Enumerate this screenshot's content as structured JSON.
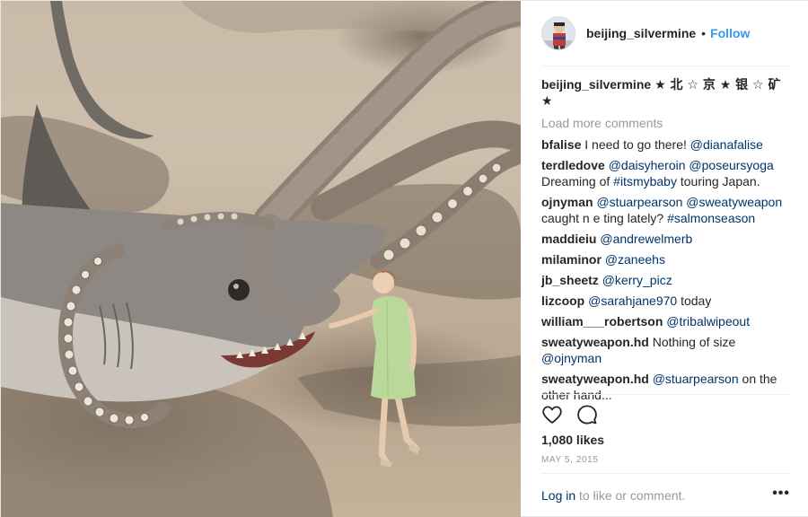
{
  "post": {
    "author": "beijing_silvermine",
    "follow_label": "Follow",
    "separator": "•",
    "caption": "★ 北 ☆ 京 ★ 银 ☆ 矿 ★",
    "load_more": "Load more comments",
    "likes": "1,080 likes",
    "date": "MAY 5, 2015",
    "login_link": "Log in",
    "login_rest": " to like or comment.",
    "more_icon": "•••"
  },
  "comments": [
    {
      "user": "bfalise",
      "parts": [
        {
          "t": "I need to go there! "
        },
        {
          "t": "@dianafalise",
          "m": true
        }
      ]
    },
    {
      "user": "terdledove",
      "parts": [
        {
          "t": "@daisyheroin",
          "m": true
        },
        {
          "t": " "
        },
        {
          "t": "@poseursyoga",
          "m": true
        },
        {
          "t": " Dreaming of "
        },
        {
          "t": "#itsmybaby",
          "m": true
        },
        {
          "t": " touring Japan."
        }
      ]
    },
    {
      "user": "ojnyman",
      "parts": [
        {
          "t": "@stuarpearson",
          "m": true
        },
        {
          "t": " "
        },
        {
          "t": "@sweatyweapon",
          "m": true
        },
        {
          "t": " caught n e ting lately? "
        },
        {
          "t": "#salmonseason",
          "m": true
        }
      ]
    },
    {
      "user": "maddieiu",
      "parts": [
        {
          "t": "@andrewelmerb",
          "m": true
        }
      ]
    },
    {
      "user": "milaminor",
      "parts": [
        {
          "t": "@zaneehs",
          "m": true
        }
      ]
    },
    {
      "user": "jb_sheetz",
      "parts": [
        {
          "t": "@kerry_picz",
          "m": true
        }
      ]
    },
    {
      "user": "lizcoop",
      "parts": [
        {
          "t": "@sarahjane970",
          "m": true
        },
        {
          "t": " today"
        }
      ]
    },
    {
      "user": "william___robertson",
      "parts": [
        {
          "t": "@tribalwipeout",
          "m": true
        }
      ]
    },
    {
      "user": "sweatyweapon.hd",
      "parts": [
        {
          "t": "Nothing of size "
        },
        {
          "t": "@ojnyman",
          "m": true
        }
      ]
    },
    {
      "user": "sweatyweapon.hd",
      "parts": [
        {
          "t": "@stuarpearson",
          "m": true
        },
        {
          "t": " on the other hand..."
        }
      ]
    }
  ],
  "icons": {
    "like": "heart-outline-icon",
    "comment": "speech-bubble-icon",
    "more": "more-options-icon"
  },
  "colors": {
    "link_blue": "#3897f0",
    "mention_navy": "#003569",
    "muted_gray": "#999999",
    "text": "#262626",
    "divider": "#efefef"
  }
}
